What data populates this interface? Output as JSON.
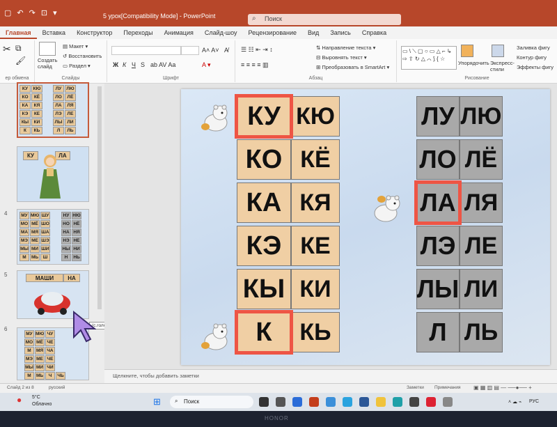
{
  "titlebar": {
    "doc_title": "5 урок[Compatibility Mode] - PowerPoint",
    "search_placeholder": "Поиск"
  },
  "tabs": [
    "Главная",
    "Вставка",
    "Конструктор",
    "Переходы",
    "Анимация",
    "Слайд-шоу",
    "Рецензирование",
    "Вид",
    "Запись",
    "Справка"
  ],
  "active_tab": "Главная",
  "ribbon": {
    "create_slide": "Создать слайд",
    "layout": "Макет",
    "reset": "Восстановить",
    "section": "Раздел",
    "slides_group": "Слайды",
    "font_group": "Шрифт",
    "paragraph_group": "Абзац",
    "drawing_group": "Рисование",
    "clipboard_group": "ер обмена",
    "text_direction": "Направление текста",
    "align_text": "Выровнять текст",
    "smartart": "Преобразовать в SmartArt",
    "arrange": "Упорядочить",
    "express": "Экспресс-стили",
    "fill": "Заливка фигу",
    "outline": "Контур фигу",
    "effects": "Эффекты фигу",
    "bold": "Ж",
    "italic": "К",
    "underline": "Ч",
    "strike": "S"
  },
  "thumbnails": {
    "slide3": {
      "left": [
        "КУ",
        "КО",
        "КА",
        "КЭ",
        "КЫ",
        "К"
      ],
      "right": [
        "ЛУ",
        "ЛО",
        "ЛА",
        "ЛЭ",
        "ЛЫ",
        "Л"
      ],
      "right2": [
        "ЛЮ",
        "ЛЁ",
        "ЛЯ",
        "ЛЕ",
        "ЛИ",
        "ЛЬ"
      ],
      "left2": [
        "КЮ",
        "КЁ",
        "КЯ",
        "КЕ",
        "КИ",
        "КЬ"
      ]
    },
    "slide_doll": {
      "num": "",
      "a": "КУ",
      "b": "ЛА"
    },
    "slide4": {
      "num": "4",
      "rows": [
        [
          "МУ",
          "МЮ",
          "ШУ",
          "",
          "НУ",
          "НЮ"
        ],
        [
          "МО",
          "МЁ",
          "ШО",
          "",
          "НО",
          "НЁ"
        ],
        [
          "МА",
          "МЯ",
          "ША",
          "",
          "НА",
          "НЯ"
        ],
        [
          "МЭ",
          "МЕ",
          "ШЭ",
          "",
          "НЭ",
          "НЕ"
        ],
        [
          "МЫ",
          "МИ",
          "ШИ",
          "",
          "НЫ",
          "НИ"
        ],
        [
          "М",
          "МЬ",
          "Ш",
          "",
          "Н",
          "НЬ"
        ]
      ]
    },
    "slide5": {
      "num": "5",
      "word": "МАШИНА",
      "a": "МАШИ",
      "b": "НА"
    },
    "slide6": {
      "num": "6",
      "rows": [
        [
          "МУ",
          "МЮ",
          "ЧУ"
        ],
        [
          "МО",
          "МЁ",
          "ЧЕ"
        ],
        [
          "М",
          "МЯ",
          "ЧА"
        ],
        [
          "МЭ",
          "МЕ",
          "ЧЕ"
        ],
        [
          "МЫ",
          "МИ",
          "ЧИ"
        ],
        [
          "М",
          "МЬ",
          "Ч",
          "ЧЬ"
        ]
      ]
    },
    "tooltip": "(с.голосвка)"
  },
  "slide": {
    "col1": [
      "КУ",
      "КО",
      "КА",
      "КЭ",
      "КЫ",
      "К"
    ],
    "col2": [
      "КЮ",
      "КЁ",
      "КЯ",
      "КЕ",
      "КИ",
      "КЬ"
    ],
    "col3": [
      "ЛУ",
      "ЛО",
      "ЛА",
      "ЛЭ",
      "ЛЫ",
      "Л"
    ],
    "col4": [
      "ЛЮ",
      "ЛЁ",
      "ЛЯ",
      "ЛЕ",
      "ЛИ",
      "ЛЬ"
    ],
    "highlighted": [
      "КУ",
      "К",
      "ЛА"
    ]
  },
  "notes_placeholder": "Щелкните, чтобы добавить заметки",
  "status": {
    "slide_info": "Слайд 2 из 8",
    "language": "русский",
    "notes_btn": "Заметки",
    "comments_btn": "Примечания"
  },
  "taskbar": {
    "weather_temp": "5°C",
    "weather_text": "Облачно",
    "search": "Поиск",
    "lang": "РУС"
  },
  "bezel_brand": "HONOR",
  "colors": {
    "accent": "#b7472a",
    "tan": "#f0cfa4",
    "gray": "#a9a9a9",
    "highlight": "#ee5545"
  }
}
